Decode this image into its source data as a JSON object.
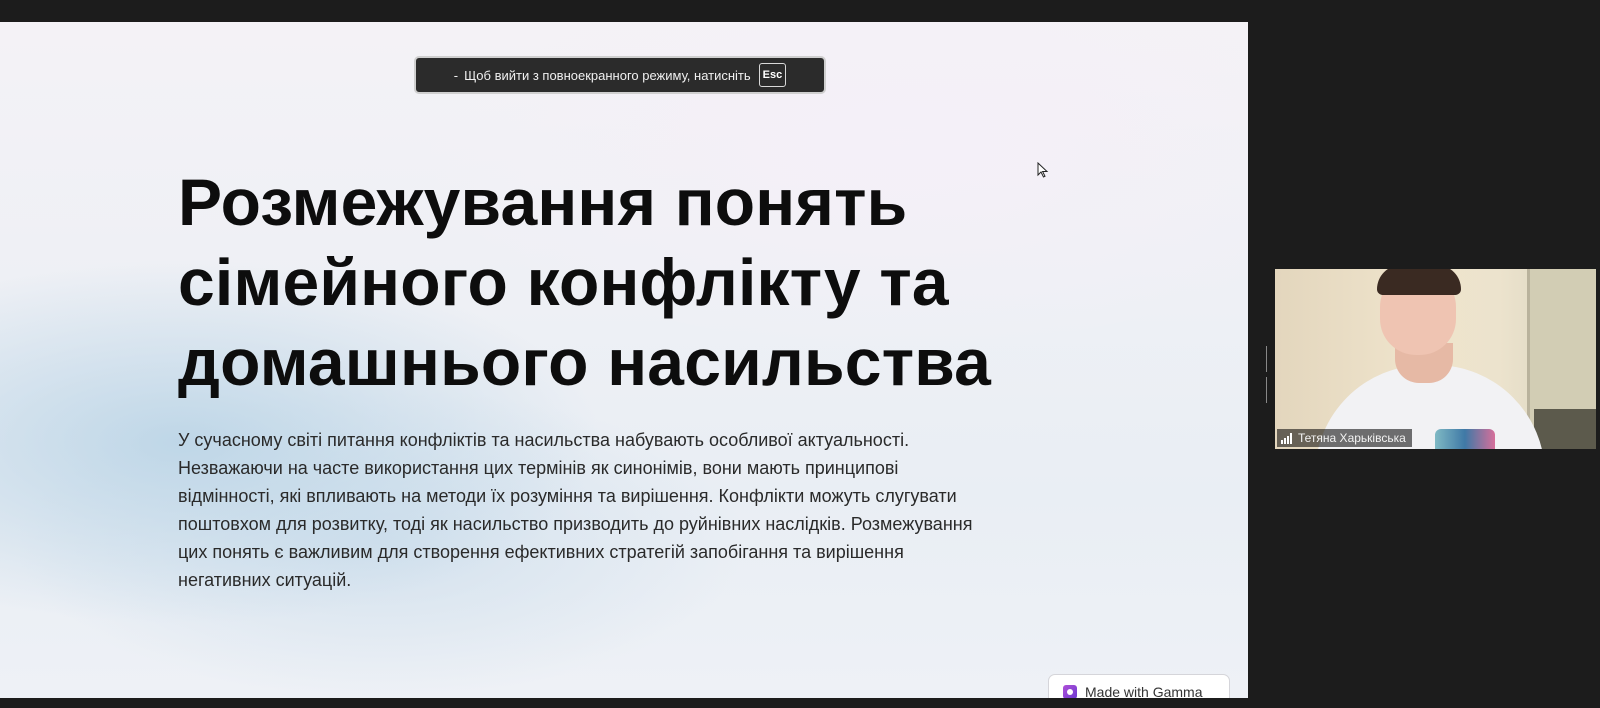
{
  "fullscreen_banner": {
    "dash": "-",
    "message": "Щоб вийти з повноекранного режиму, натисніть",
    "key": "Esc"
  },
  "slide": {
    "title_lines": [
      "Розмежування понять",
      "сімейного конфлікту та",
      "домашнього насильства"
    ],
    "body_lines": [
      " У сучасному світі питання конфліктів та насильства набувають особливої актуальності.",
      "Незважаючи на часте використання цих термінів як синонімів, вони мають принципові",
      "відмінності, які впливають на методи їх розуміння та вирішення. Конфлікти можуть слугувати",
      "поштовхом для розвитку, тоді як насильство призводить до руйнівних наслідків. Розмежування",
      "цих понять є важливим для створення ефективних стратегій запобігання та вирішення",
      "негативних ситуацій."
    ],
    "badge": {
      "label": "Made with Gamma",
      "icon": "gamma-logo-icon"
    }
  },
  "participant": {
    "name": "Тетяна Харьківська",
    "icon": "signal-strength-icon"
  },
  "colors": {
    "app_background": "#1c1c1c",
    "title": "#0d0d0d",
    "body_text": "#2a2a2a",
    "gamma_accent": "#b04fd8"
  }
}
